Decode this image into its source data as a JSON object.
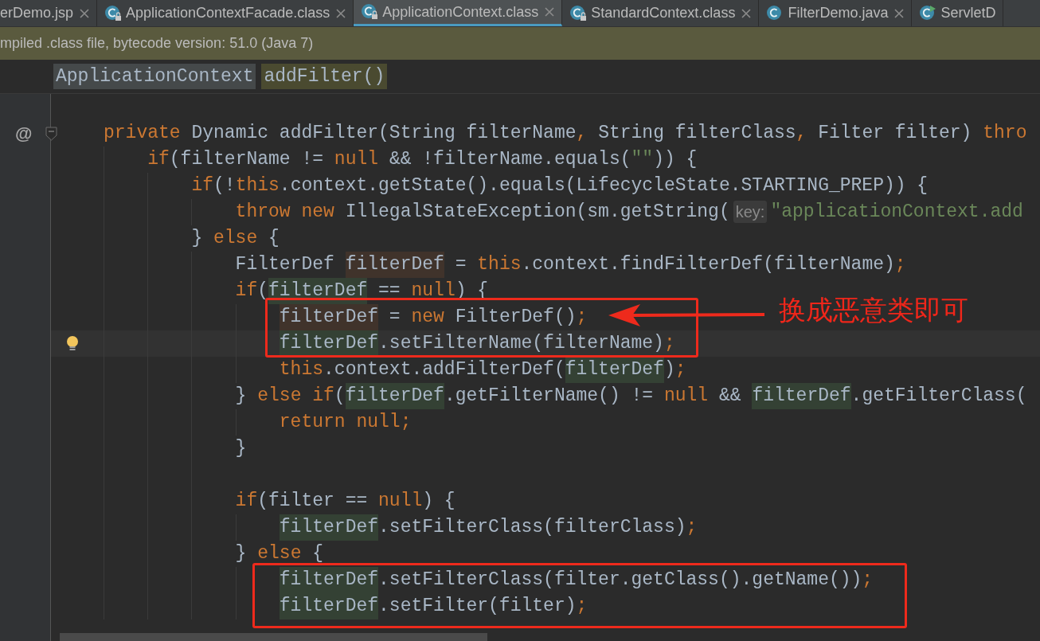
{
  "tabs": [
    {
      "label": "erDemo.jsp",
      "kind": "plain",
      "selected": false,
      "closable": true
    },
    {
      "label": "ApplicationContextFacade.class",
      "kind": "class",
      "selected": false,
      "closable": true
    },
    {
      "label": "ApplicationContext.class",
      "kind": "class",
      "selected": true,
      "closable": true
    },
    {
      "label": "StandardContext.class",
      "kind": "class",
      "selected": false,
      "closable": true
    },
    {
      "label": "FilterDemo.java",
      "kind": "java",
      "selected": false,
      "closable": true
    },
    {
      "label": "ServletD",
      "kind": "runnable",
      "selected": false,
      "closable": false
    }
  ],
  "banner": "mpiled .class file, bytecode version: 51.0 (Java 7)",
  "breadcrumbs": [
    {
      "label": "ApplicationContext",
      "kind": "class"
    },
    {
      "label": "addFilter()",
      "kind": "method"
    }
  ],
  "code": [
    {
      "gutter_mark": "@",
      "current": false,
      "tokens": [
        {
          "kind": "kw",
          "t": "private"
        },
        {
          "kind": "plain",
          "t": " Dynamic addFilter(String filterName"
        },
        {
          "kind": "kw",
          "t": ","
        },
        {
          "kind": "plain",
          "t": " String filterClass"
        },
        {
          "kind": "kw",
          "t": ","
        },
        {
          "kind": "plain",
          "t": " Filter filter) "
        },
        {
          "kind": "kw",
          "t": "thro"
        }
      ],
      "children": [
        {
          "current": false,
          "tokens": [
            {
              "kind": "kw",
              "t": "if"
            },
            {
              "kind": "plain",
              "t": "(filterName != "
            },
            {
              "kind": "kw",
              "t": "null"
            },
            {
              "kind": "plain",
              "t": " && !filterName.equals("
            },
            {
              "kind": "str",
              "t": "\"\""
            },
            {
              "kind": "plain",
              "t": ")) {"
            }
          ],
          "children": [
            {
              "current": false,
              "tokens": [
                {
                  "kind": "kw",
                  "t": "if"
                },
                {
                  "kind": "plain",
                  "t": "(!"
                },
                {
                  "kind": "kw",
                  "t": "this"
                },
                {
                  "kind": "plain",
                  "t": ".context.getState().equals(LifecycleState.STARTING_PREP)) {"
                }
              ],
              "children": [
                {
                  "current": false,
                  "tokens": [
                    {
                      "kind": "kw",
                      "t": "throw new"
                    },
                    {
                      "kind": "plain",
                      "t": " IllegalStateException(sm.getString("
                    },
                    {
                      "kind": "hint",
                      "t": "key:"
                    },
                    {
                      "kind": "str",
                      "t": "\"applicationContext.add"
                    }
                  ]
                }
              ]
            },
            {
              "current": false,
              "tokens": [
                {
                  "kind": "plain",
                  "t": "} "
                },
                {
                  "kind": "kw",
                  "t": "else"
                },
                {
                  "kind": "plain",
                  "t": " {"
                }
              ],
              "children": [
                {
                  "current": false,
                  "tokens": [
                    {
                      "kind": "plain",
                      "t": "FilterDef "
                    },
                    {
                      "kind": "write",
                      "t": "filterDef"
                    },
                    {
                      "kind": "plain",
                      "t": " = "
                    },
                    {
                      "kind": "kw",
                      "t": "this"
                    },
                    {
                      "kind": "plain",
                      "t": ".context.findFilterDef(filterName)"
                    },
                    {
                      "kind": "kw",
                      "t": ";"
                    }
                  ]
                },
                {
                  "current": false,
                  "tokens": [
                    {
                      "kind": "kw",
                      "t": "if"
                    },
                    {
                      "kind": "plain",
                      "t": "("
                    },
                    {
                      "kind": "read",
                      "t": "filterDef"
                    },
                    {
                      "kind": "plain",
                      "t": " == "
                    },
                    {
                      "kind": "kw",
                      "t": "null"
                    },
                    {
                      "kind": "plain",
                      "t": ") {"
                    }
                  ],
                  "children": [
                    {
                      "current": false,
                      "tokens": [
                        {
                          "kind": "write",
                          "t": "filterDef"
                        },
                        {
                          "kind": "plain",
                          "t": " = "
                        },
                        {
                          "kind": "kw",
                          "t": "new"
                        },
                        {
                          "kind": "plain",
                          "t": " FilterDef()"
                        },
                        {
                          "kind": "kw",
                          "t": ";"
                        }
                      ]
                    },
                    {
                      "current": true,
                      "tokens": [
                        {
                          "kind": "read",
                          "t": "filterDef"
                        },
                        {
                          "kind": "plain",
                          "t": ".setFilterName(filterName)"
                        },
                        {
                          "kind": "kw",
                          "t": ";"
                        }
                      ]
                    },
                    {
                      "current": false,
                      "tokens": [
                        {
                          "kind": "kw",
                          "t": "this"
                        },
                        {
                          "kind": "plain",
                          "t": ".context.addFilterDef("
                        },
                        {
                          "kind": "read",
                          "t": "filterDef"
                        },
                        {
                          "kind": "plain",
                          "t": ")"
                        },
                        {
                          "kind": "kw",
                          "t": ";"
                        }
                      ]
                    }
                  ]
                },
                {
                  "current": false,
                  "tokens": [
                    {
                      "kind": "plain",
                      "t": "} "
                    },
                    {
                      "kind": "kw",
                      "t": "else if"
                    },
                    {
                      "kind": "plain",
                      "t": "("
                    },
                    {
                      "kind": "read",
                      "t": "filterDef"
                    },
                    {
                      "kind": "plain",
                      "t": ".getFilterName() != "
                    },
                    {
                      "kind": "kw",
                      "t": "null"
                    },
                    {
                      "kind": "plain",
                      "t": " && "
                    },
                    {
                      "kind": "read",
                      "t": "filterDef"
                    },
                    {
                      "kind": "plain",
                      "t": ".getFilterClass("
                    }
                  ],
                  "children": [
                    {
                      "current": false,
                      "tokens": [
                        {
                          "kind": "kw",
                          "t": "return null;"
                        }
                      ]
                    }
                  ]
                },
                {
                  "current": false,
                  "tokens": [
                    {
                      "kind": "plain",
                      "t": "}"
                    }
                  ]
                },
                {
                  "kind": "blank"
                },
                {
                  "current": false,
                  "tokens": [
                    {
                      "kind": "kw",
                      "t": "if"
                    },
                    {
                      "kind": "plain",
                      "t": "(filter == "
                    },
                    {
                      "kind": "kw",
                      "t": "null"
                    },
                    {
                      "kind": "plain",
                      "t": ") {"
                    }
                  ],
                  "children": [
                    {
                      "current": false,
                      "tokens": [
                        {
                          "kind": "read",
                          "t": "filterDef"
                        },
                        {
                          "kind": "plain",
                          "t": ".setFilterClass(filterClass)"
                        },
                        {
                          "kind": "kw",
                          "t": ";"
                        }
                      ]
                    }
                  ]
                },
                {
                  "current": false,
                  "tokens": [
                    {
                      "kind": "plain",
                      "t": "} "
                    },
                    {
                      "kind": "kw",
                      "t": "else"
                    },
                    {
                      "kind": "plain",
                      "t": " {"
                    }
                  ],
                  "children": [
                    {
                      "current": false,
                      "tokens": [
                        {
                          "kind": "read",
                          "t": "filterDef"
                        },
                        {
                          "kind": "plain",
                          "t": ".setFilterClass(filter.getClass().getName())"
                        },
                        {
                          "kind": "kw",
                          "t": ";"
                        }
                      ]
                    },
                    {
                      "current": false,
                      "tokens": [
                        {
                          "kind": "read",
                          "t": "filterDef"
                        },
                        {
                          "kind": "plain",
                          "t": ".setFilter(filter)"
                        },
                        {
                          "kind": "kw",
                          "t": ";"
                        }
                      ]
                    }
                  ]
                }
              ]
            }
          ]
        }
      ]
    }
  ],
  "annotation": {
    "label": "换成恶意类即可"
  }
}
